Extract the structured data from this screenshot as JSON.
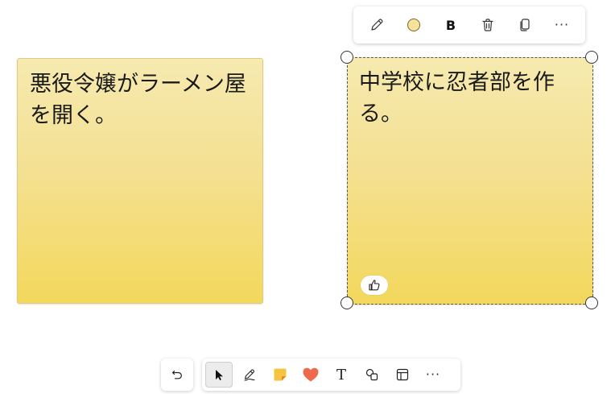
{
  "notes": [
    {
      "id": "note1",
      "text": "悪役令嬢がラーメン屋を開く。",
      "selected": false
    },
    {
      "id": "note2",
      "text": "中学校に忍者部を作る。",
      "selected": true
    }
  ],
  "context_toolbar": {
    "items": [
      "edit-pen",
      "color",
      "bold",
      "delete",
      "copy",
      "more"
    ],
    "bold_label": "B",
    "more_label": "···",
    "swatch_color": "#f6e29a"
  },
  "bottom_toolbar": {
    "items": [
      "select",
      "pen",
      "sticky-note",
      "reaction",
      "text",
      "shapes",
      "template",
      "more"
    ],
    "active": "select",
    "text_tool_label": "T",
    "more_label": "···"
  },
  "colors": {
    "note_top": "#f6eab0",
    "note_bottom": "#f3d85c",
    "heart": "#ef6a4c",
    "sticky": "#f5c542"
  }
}
